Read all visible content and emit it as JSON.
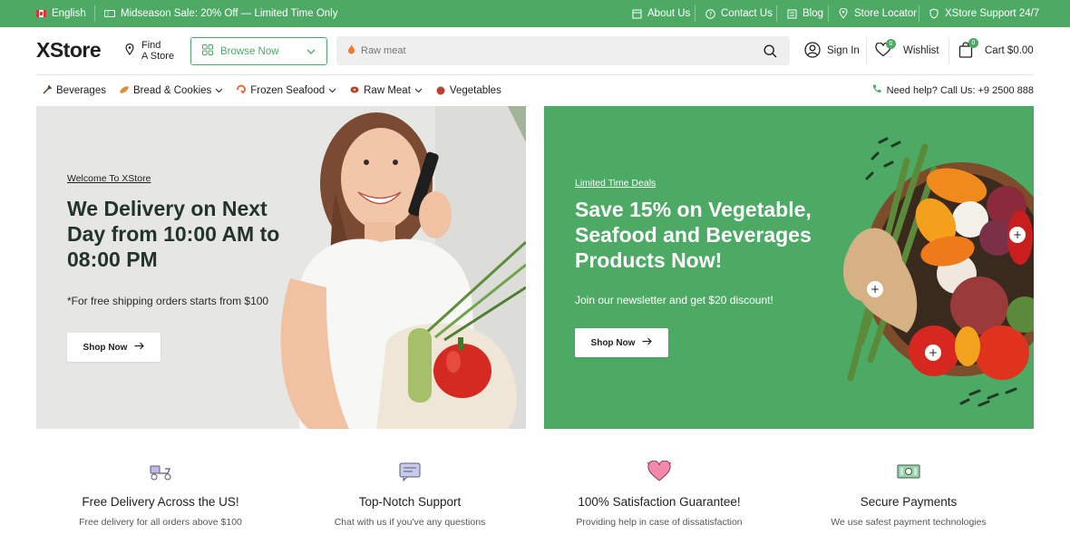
{
  "topbar": {
    "language": "English",
    "promo": "Midseason Sale: 20% Off — Limited Time Only",
    "links": [
      "About Us",
      "Contact Us",
      "Blog",
      "Store Locator",
      "XStore Support 24/7"
    ]
  },
  "header": {
    "logo": "XStore",
    "find_store_line1": "Find",
    "find_store_line2": "A Store",
    "browse_label": "Browse Now",
    "search_placeholder": "Raw meat",
    "sign_in": "Sign In",
    "wishlist": "Wishlist",
    "wishlist_count": "0",
    "cart": "Cart $0.00",
    "cart_count": "0"
  },
  "categories": [
    "Beverages",
    "Bread & Cookies",
    "Frozen Seafood",
    "Raw Meat",
    "Vegetables"
  ],
  "help_text": "Need help? Call Us: +9 2500 888",
  "hero_left": {
    "eyebrow": "Welcome To XStore",
    "title_line1": "We Delivery on Next",
    "title_line2": "Day from 10:00 AM to",
    "title_line3": "08:00 PM",
    "subtitle": "*For free shipping orders starts from $100",
    "button": "Shop Now"
  },
  "hero_right": {
    "eyebrow": "Limited Time Deals",
    "title_line1": "Save 15% on Vegetable,",
    "title_line2": "Seafood and Beverages",
    "title_line3": "Products Now!",
    "subtitle": "Join our newsletter and get $20 discount!",
    "button": "Shop Now"
  },
  "features": [
    {
      "title": "Free Delivery Across the US!",
      "desc": "Free delivery for all orders above $100"
    },
    {
      "title": "Top-Notch Support",
      "desc": "Chat with us if you've any questions"
    },
    {
      "title": "100% Satisfaction Guarantee!",
      "desc": "Providing help in case of dissatisfaction"
    },
    {
      "title": "Secure Payments",
      "desc": "We use safest payment technologies"
    }
  ],
  "colors": {
    "brand_green": "#4caa64",
    "text_dark": "#1f1f1f"
  }
}
